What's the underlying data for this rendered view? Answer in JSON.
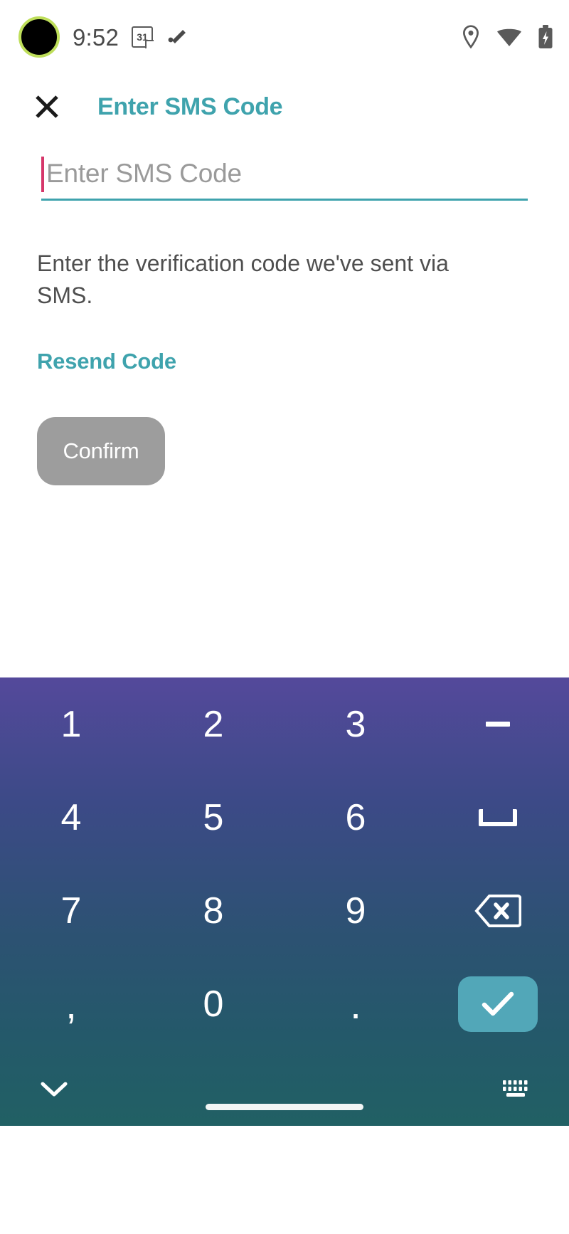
{
  "status_bar": {
    "time": "9:52",
    "calendar_day": "31",
    "icons": {
      "camera_cutout": "camera-cutout",
      "calendar": "calendar-icon",
      "check_slash": "check-slash-icon",
      "location": "location-pin-icon",
      "wifi": "wifi-icon",
      "battery": "battery-charging-icon"
    }
  },
  "header": {
    "close_label": "close-icon",
    "title": "Enter SMS Code",
    "title_color": "#3fa3ad"
  },
  "form": {
    "input": {
      "value": "",
      "placeholder": "Enter SMS Code",
      "underline_color": "#3fa3ad",
      "caret_color": "#d6376a"
    },
    "description": "Enter the verification code we've sent via SMS.",
    "resend_label": "Resend Code",
    "confirm_label": "Confirm",
    "confirm_state": "disabled",
    "confirm_color": "#9d9d9d"
  },
  "keyboard": {
    "type": "numeric",
    "accent_color": "#52a7b8",
    "keys": [
      {
        "label": "1",
        "name": "key-1",
        "glyph": "text"
      },
      {
        "label": "2",
        "name": "key-2",
        "glyph": "text"
      },
      {
        "label": "3",
        "name": "key-3",
        "glyph": "text"
      },
      {
        "label": "-",
        "name": "key-dash",
        "glyph": "dash"
      },
      {
        "label": "4",
        "name": "key-4",
        "glyph": "text"
      },
      {
        "label": "5",
        "name": "key-5",
        "glyph": "text"
      },
      {
        "label": "6",
        "name": "key-6",
        "glyph": "text"
      },
      {
        "label": "space",
        "name": "key-space",
        "glyph": "space"
      },
      {
        "label": "7",
        "name": "key-7",
        "glyph": "text"
      },
      {
        "label": "8",
        "name": "key-8",
        "glyph": "text"
      },
      {
        "label": "9",
        "name": "key-9",
        "glyph": "text"
      },
      {
        "label": "backspace",
        "name": "key-backspace",
        "glyph": "backspace"
      },
      {
        "label": ",",
        "name": "key-comma",
        "glyph": "text"
      },
      {
        "label": "0",
        "name": "key-0",
        "glyph": "text"
      },
      {
        "label": ".",
        "name": "key-period",
        "glyph": "text"
      },
      {
        "label": "enter",
        "name": "key-enter",
        "glyph": "check"
      }
    ],
    "bottom_bar": {
      "hide_keyboard": "chevron-down-icon",
      "switch_keyboard": "keyboard-switch-icon"
    }
  },
  "system_nav": {
    "home_indicator": "home-indicator"
  }
}
